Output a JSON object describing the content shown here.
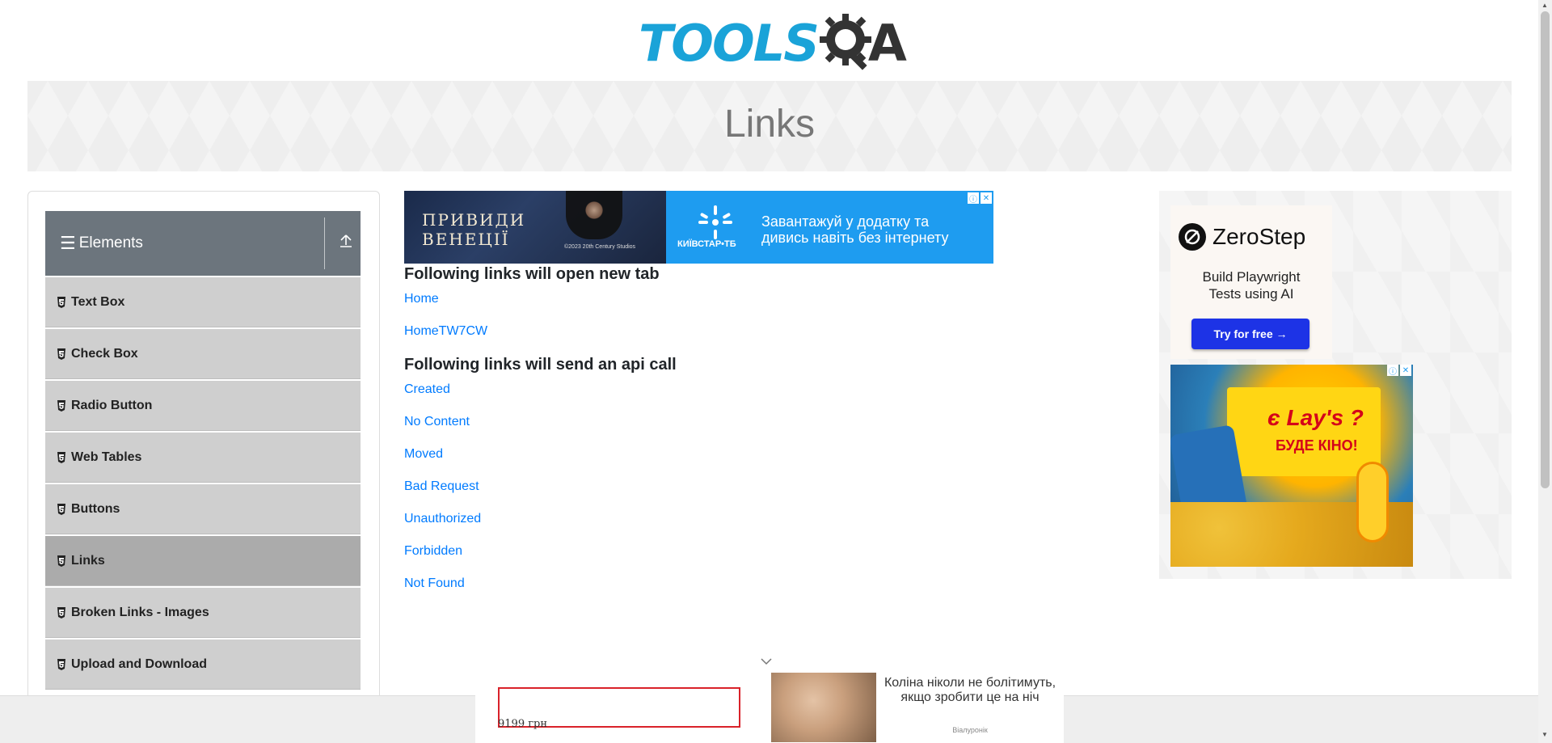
{
  "logo": {
    "text": "TOOLS",
    "suffix": "A"
  },
  "banner": {
    "title": "Links"
  },
  "sidebar": {
    "group_title": "Elements",
    "items": [
      {
        "label": "Text Box",
        "active": false
      },
      {
        "label": "Check Box",
        "active": false
      },
      {
        "label": "Radio Button",
        "active": false
      },
      {
        "label": "Web Tables",
        "active": false
      },
      {
        "label": "Buttons",
        "active": false
      },
      {
        "label": "Links",
        "active": true
      },
      {
        "label": "Broken Links - Images",
        "active": false
      },
      {
        "label": "Upload and Download",
        "active": false
      }
    ]
  },
  "top_ad": {
    "left_line1": "ПРИВИДИ",
    "left_line2": "ВЕНЕЦІЇ",
    "left_copyright": "©2023 20th Century Studios",
    "brand": "КИЇВСТАР•ТБ",
    "right_line1": "Завантажуй у додатку та",
    "right_line2": "дивись навіть без інтернету"
  },
  "main": {
    "new_tab_heading": "Following links will open new tab",
    "new_tab_links": [
      "Home",
      "HomeTW7CW"
    ],
    "api_heading": "Following links will send an api call",
    "api_links": [
      "Created",
      "No Content",
      "Moved",
      "Bad Request",
      "Unauthorized",
      "Forbidden",
      "Not Found"
    ]
  },
  "right_ad": {
    "zerostep_name": "ZeroStep",
    "zerostep_line1": "Build Playwright",
    "zerostep_line2": "Tests using AI",
    "zerostep_button": "Try for free →",
    "lays_brand": "є Lay's ?",
    "lays_kino": "БУДЕ КІНО!"
  },
  "bottom_ad": {
    "price": "9199 грн",
    "text": "Коліна ніколи не болітимуть, якщо зробити це на ніч",
    "brand": "Віалуронік"
  },
  "colors": {
    "link": "#007bff",
    "sidebar_header": "#6c757d",
    "sidebar_item": "#cfcfcf",
    "sidebar_item_active": "#ababab",
    "logo_blue": "#1aa3d8"
  }
}
